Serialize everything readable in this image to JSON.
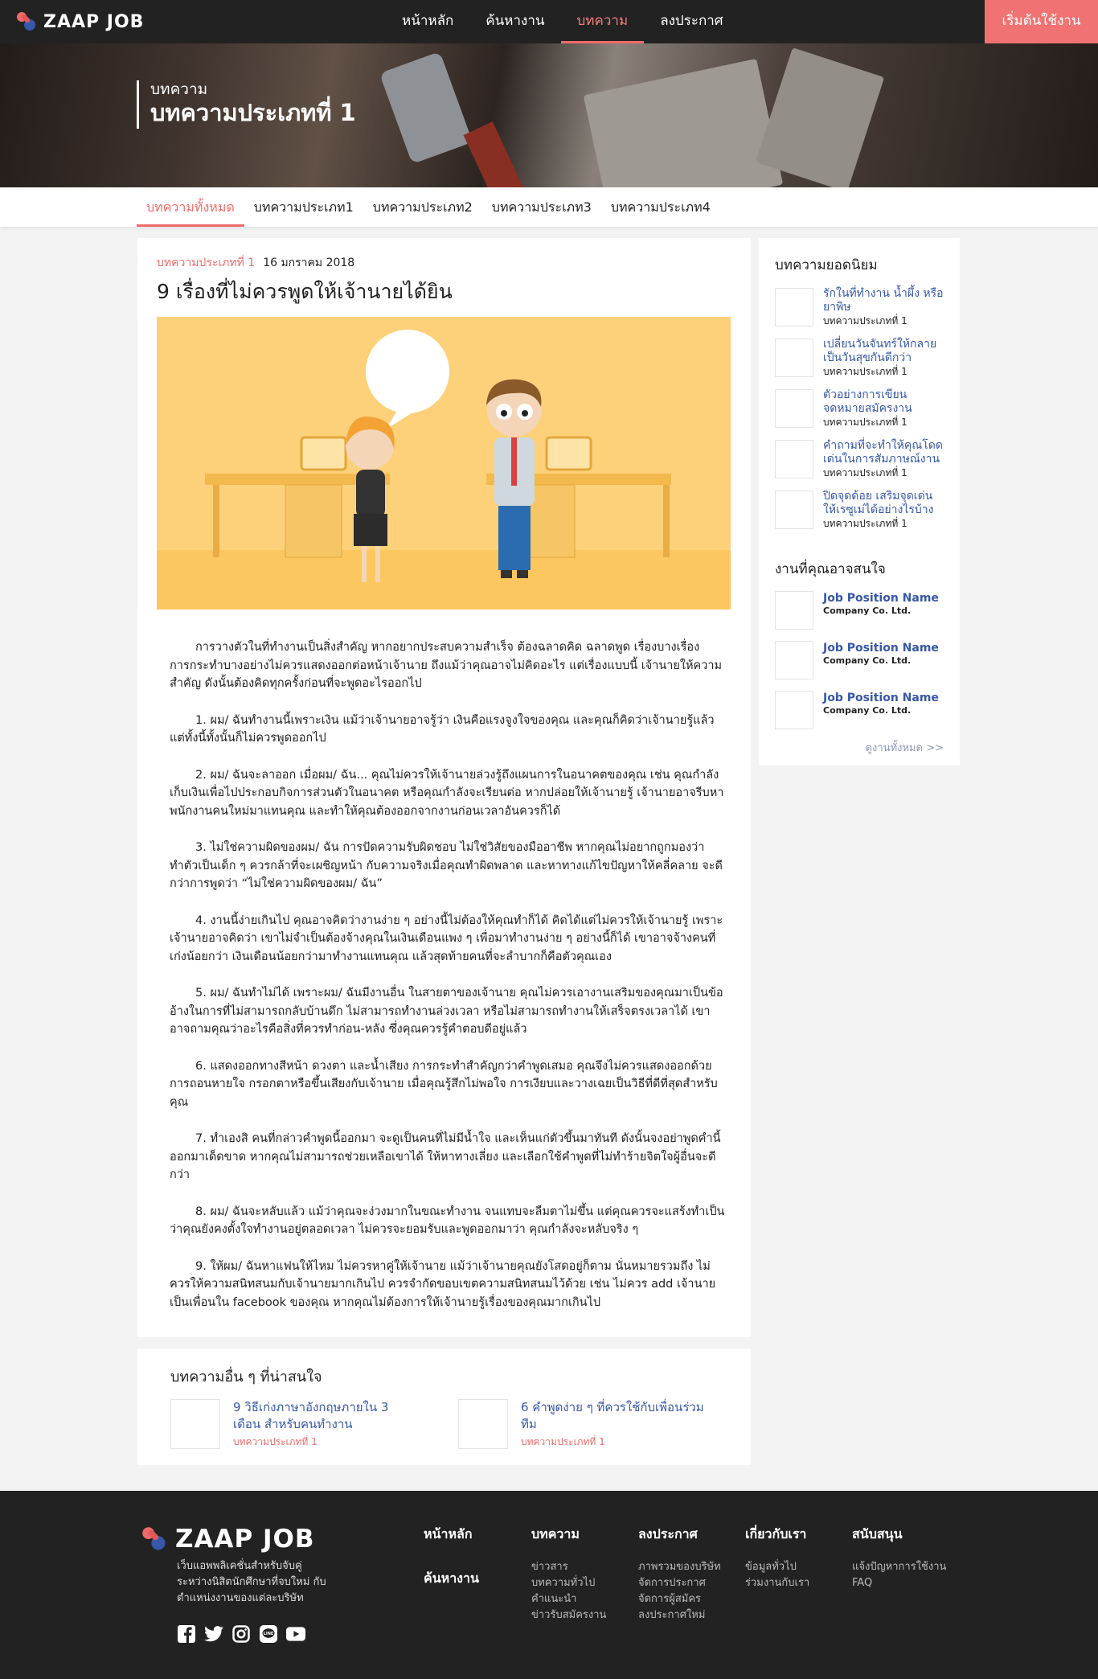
{
  "nav": {
    "logo": "ZAAP JOB",
    "links": [
      "หน้าหลัก",
      "ค้นหางาน",
      "บทความ",
      "ลงประกาศ"
    ],
    "active": "บทความ",
    "start_button": "เริ่มต้นใช้งาน"
  },
  "hero": {
    "subtitle": "บทความ",
    "title": "บทความประเภทที่ 1"
  },
  "tabs": [
    "บทความทั้งหมด",
    "บทความประเภท1",
    "บทความประเภท2",
    "บทความประเภท3",
    "บทความประเภท4"
  ],
  "article": {
    "category": "บทความประเภทที่ 1",
    "date": "16 มกราคม 2018",
    "title": "9 เรื่องที่ไม่ควรพูดให้เจ้านายได้ยิน",
    "paragraphs": [
      "การวางตัวในที่ทำงานเป็นสิ่งสำคัญ หากอยากประสบความสำเร็จ ต้องฉลาดคิด ฉลาดพูด เรื่องบางเรื่อง การกระทำบางอย่างไม่ควรแสดงออกต่อหน้าเจ้านาย ถึงแม้ว่าคุณอาจไม่คิดอะไร แต่เรื่องแบบนี้ เจ้านายให้ความสำคัญ ดังนั้นต้องคิดทุกครั้งก่อนที่จะพูดอะไรออกไป",
      "1. ผม/ ฉันทำงานนี้เพราะเงิน แม้ว่าเจ้านายอาจรู้ว่า เงินคือแรงจูงใจของคุณ และคุณก็คิดว่าเจ้านายรู้แล้ว แต่ทั้งนี้ทั้งนั้นก็ไม่ควรพูดออกไป",
      "2. ผม/ ฉันจะลาออก เมื่อผม/ ฉัน... คุณไม่ควรให้เจ้านายล่วงรู้ถึงแผนการในอนาคตของคุณ เช่น คุณกำลังเก็บเงินเพื่อไปประกอบกิจการส่วนตัวในอนาคต หรือคุณกำลังจะเรียนต่อ หากปล่อยให้เจ้านายรู้ เจ้านายอาจรีบหาพนักงานคนใหม่มาแทนคุณ และทำให้คุณต้องออกจากงานก่อนเวลาอันควรก็ได้",
      "3. ไม่ใช่ความผิดของผม/ ฉัน การปัดความรับผิดชอบ ไม่ใช่วิสัยของมืออาชีพ หากคุณไม่อยากถูกมองว่าทำตัวเป็นเด็ก ๆ ควรกล้าที่จะเผชิญหน้า กับความจริงเมื่อคุณทำผิดพลาด และหาทางแก้ไขปัญหาให้คลี่คลาย จะดีกว่าการพูดว่า “ไม่ใช่ความผิดของผม/ ฉัน”",
      "4. งานนี้ง่ายเกินไป คุณอาจคิดว่างานง่าย ๆ อย่างนี้ไม่ต้องให้คุณทำก็ได้ คิดได้แต่ไม่ควรให้เจ้านายรู้ เพราะเจ้านายอาจคิดว่า เขาไม่จำเป็นต้องจ้างคุณในเงินเดือนแพง ๆ เพื่อมาทำงานง่าย ๆ อย่างนี้ก็ได้ เขาอาจจ้างคนที่เก่งน้อยกว่า เงินเดือนน้อยกว่ามาทำงานแทนคุณ แล้วสุดท้ายคนที่จะลำบากก็คือตัวคุณเอง",
      "5. ผม/ ฉันทำไม่ได้ เพราะผม/ ฉันมีงานอื่น ในสายตาของเจ้านาย คุณไม่ควรเอางานเสริมของคุณมาเป็นข้ออ้างในการที่ไม่สามารถกลับบ้านดึก ไม่สามารถทำงานล่วงเวลา หรือไม่สามารถทำงานให้เสร็จตรงเวลาได้ เขาอาจถามคุณว่าอะไรคือสิ่งที่ควรทำก่อน-หลัง ซึ่งคุณควรรู้คำตอบดีอยู่แล้ว",
      "6. แสดงออกทางสีหน้า ดวงตา และน้ำเสียง การกระทำสำคัญกว่าคำพูดเสมอ คุณจึงไม่ควรแสดงออกด้วยการถอนหายใจ กรอกตาหรือขึ้นเสียงกับเจ้านาย เมื่อคุณรู้สึกไม่พอใจ การเงียบและวางเฉยเป็นวิธีที่ดีที่สุดสำหรับคุณ",
      "7. ทำเองสิ คนที่กล่าวคำพูดนี้ออกมา จะดูเป็นคนที่ไม่มีน้ำใจ และเห็นแก่ตัวขึ้นมาทันที ดังนั้นจงอย่าพูดคำนี้ออกมาเด็ดขาด หากคุณไม่สามารถช่วยเหลือเขาได้ ให้หาทางเลี่ยง และเลือกใช้คำพูดที่ไม่ทำร้ายจิตใจผู้อื่นจะดีกว่า",
      "8. ผม/ ฉันจะหลับแล้ว แม้ว่าคุณจะง่วงมากในขณะทำงาน จนแทบจะลืมตาไม่ขึ้น แต่คุณควรจะแสร้งทำเป็นว่าคุณยังคงตั้งใจทำงานอยู่ตลอดเวลา ไม่ควรจะยอมรับและพูดออกมาว่า คุณกำลังจะหลับจริง ๆ",
      "9. ให้ผม/ ฉันหาแฟนให้ไหม ไม่ควรหาคู่ให้เจ้านาย แม้ว่าเจ้านายคุณยังโสดอยู่ก็ตาม นั่นหมายรวมถึง ไม่ควรให้ความสนิทสนมกับเจ้านายมากเกินไป ควรจำกัดขอบเขตความสนิทสนมไว้ด้วย เช่น ไม่ควร add เจ้านายเป็นเพื่อนใน facebook ของคุณ หากคุณไม่ต้องการให้เจ้านายรู้เรื่องของคุณมากเกินไป"
    ]
  },
  "related": {
    "heading": "บทความอื่น ๆ ที่น่าสนใจ",
    "items": [
      {
        "title": "9 วิธีเก่งภาษาอังกฤษภายใน 3 เดือน สำหรับคนทำงาน",
        "category": "บทความประเภทที่ 1"
      },
      {
        "title": "6 คำพูดง่าย ๆ ที่ควรใช้กับเพื่อนร่วมทีม",
        "category": "บทความประเภทที่ 1"
      }
    ]
  },
  "sidebar": {
    "popular_heading": "บทความยอดนิยม",
    "popular": [
      {
        "title": "รักในที่ทำงาน น้ำผึ้ง หรือยาพิษ",
        "category": "บทความประเภทที่ 1"
      },
      {
        "title": "เปลี่ยนวันจันทร์ให้กลายเป็นวันสุขกันดีกว่า",
        "category": "บทความประเภทที่ 1"
      },
      {
        "title": "ตัวอย่างการเขียนจดหมายสมัครงาน",
        "category": "บทความประเภทที่ 1"
      },
      {
        "title": "คำถามที่จะทำให้คุณโดดเด่นในการสัมภาษณ์งาน",
        "category": "บทความประเภทที่ 1"
      },
      {
        "title": "ปิดจุดด้อย เสริมจุดเด่น ให้เรซูเม่ได้อย่างไรบ้าง",
        "category": "บทความประเภทที่ 1"
      }
    ],
    "jobs_heading": "งานที่คุณอาจสนใจ",
    "jobs": [
      {
        "title": "Job Position Name",
        "company": "Company Co. Ltd."
      },
      {
        "title": "Job Position Name",
        "company": "Company Co. Ltd."
      },
      {
        "title": "Job Position Name",
        "company": "Company Co. Ltd."
      }
    ],
    "see_all": "ดูงานทั้งหมด >>"
  },
  "footer": {
    "logo": "ZAAP JOB",
    "description": "เว็บแอพพลิเคชั่นสำหรับจับคู่ ระหว่างนิสิตนักศึกษาที่จบใหม่ กับตำแหน่งงานของแต่ละบริษัท",
    "col_main": [
      "หน้าหลัก",
      "ค้นหางาน"
    ],
    "columns": [
      {
        "heading": "บทความ",
        "links": [
          "ข่าวสาร",
          "บทความทั่วไป",
          "คำแนะนำ",
          "ข่าวรับสมัครงาน"
        ]
      },
      {
        "heading": "ลงประกาศ",
        "links": [
          "ภาพรวมของบริษัท",
          "จัดการประกาศ",
          "จัดการผู้สมัคร",
          "ลงประกาศใหม่"
        ]
      },
      {
        "heading": "เกี่ยวกับเรา",
        "links": [
          "ข้อมูลทั่วไป",
          "ร่วมงานกับเรา"
        ]
      },
      {
        "heading": "สนับสนุน",
        "links": [
          "แจ้งปัญหาการใช้งาน",
          "FAQ"
        ]
      }
    ],
    "socials": [
      "facebook-icon",
      "twitter-icon",
      "instagram-icon",
      "line-icon",
      "youtube-icon"
    ]
  },
  "colors": {
    "accent": "#f06a6a",
    "link": "#3757a8",
    "dark": "#222222"
  }
}
